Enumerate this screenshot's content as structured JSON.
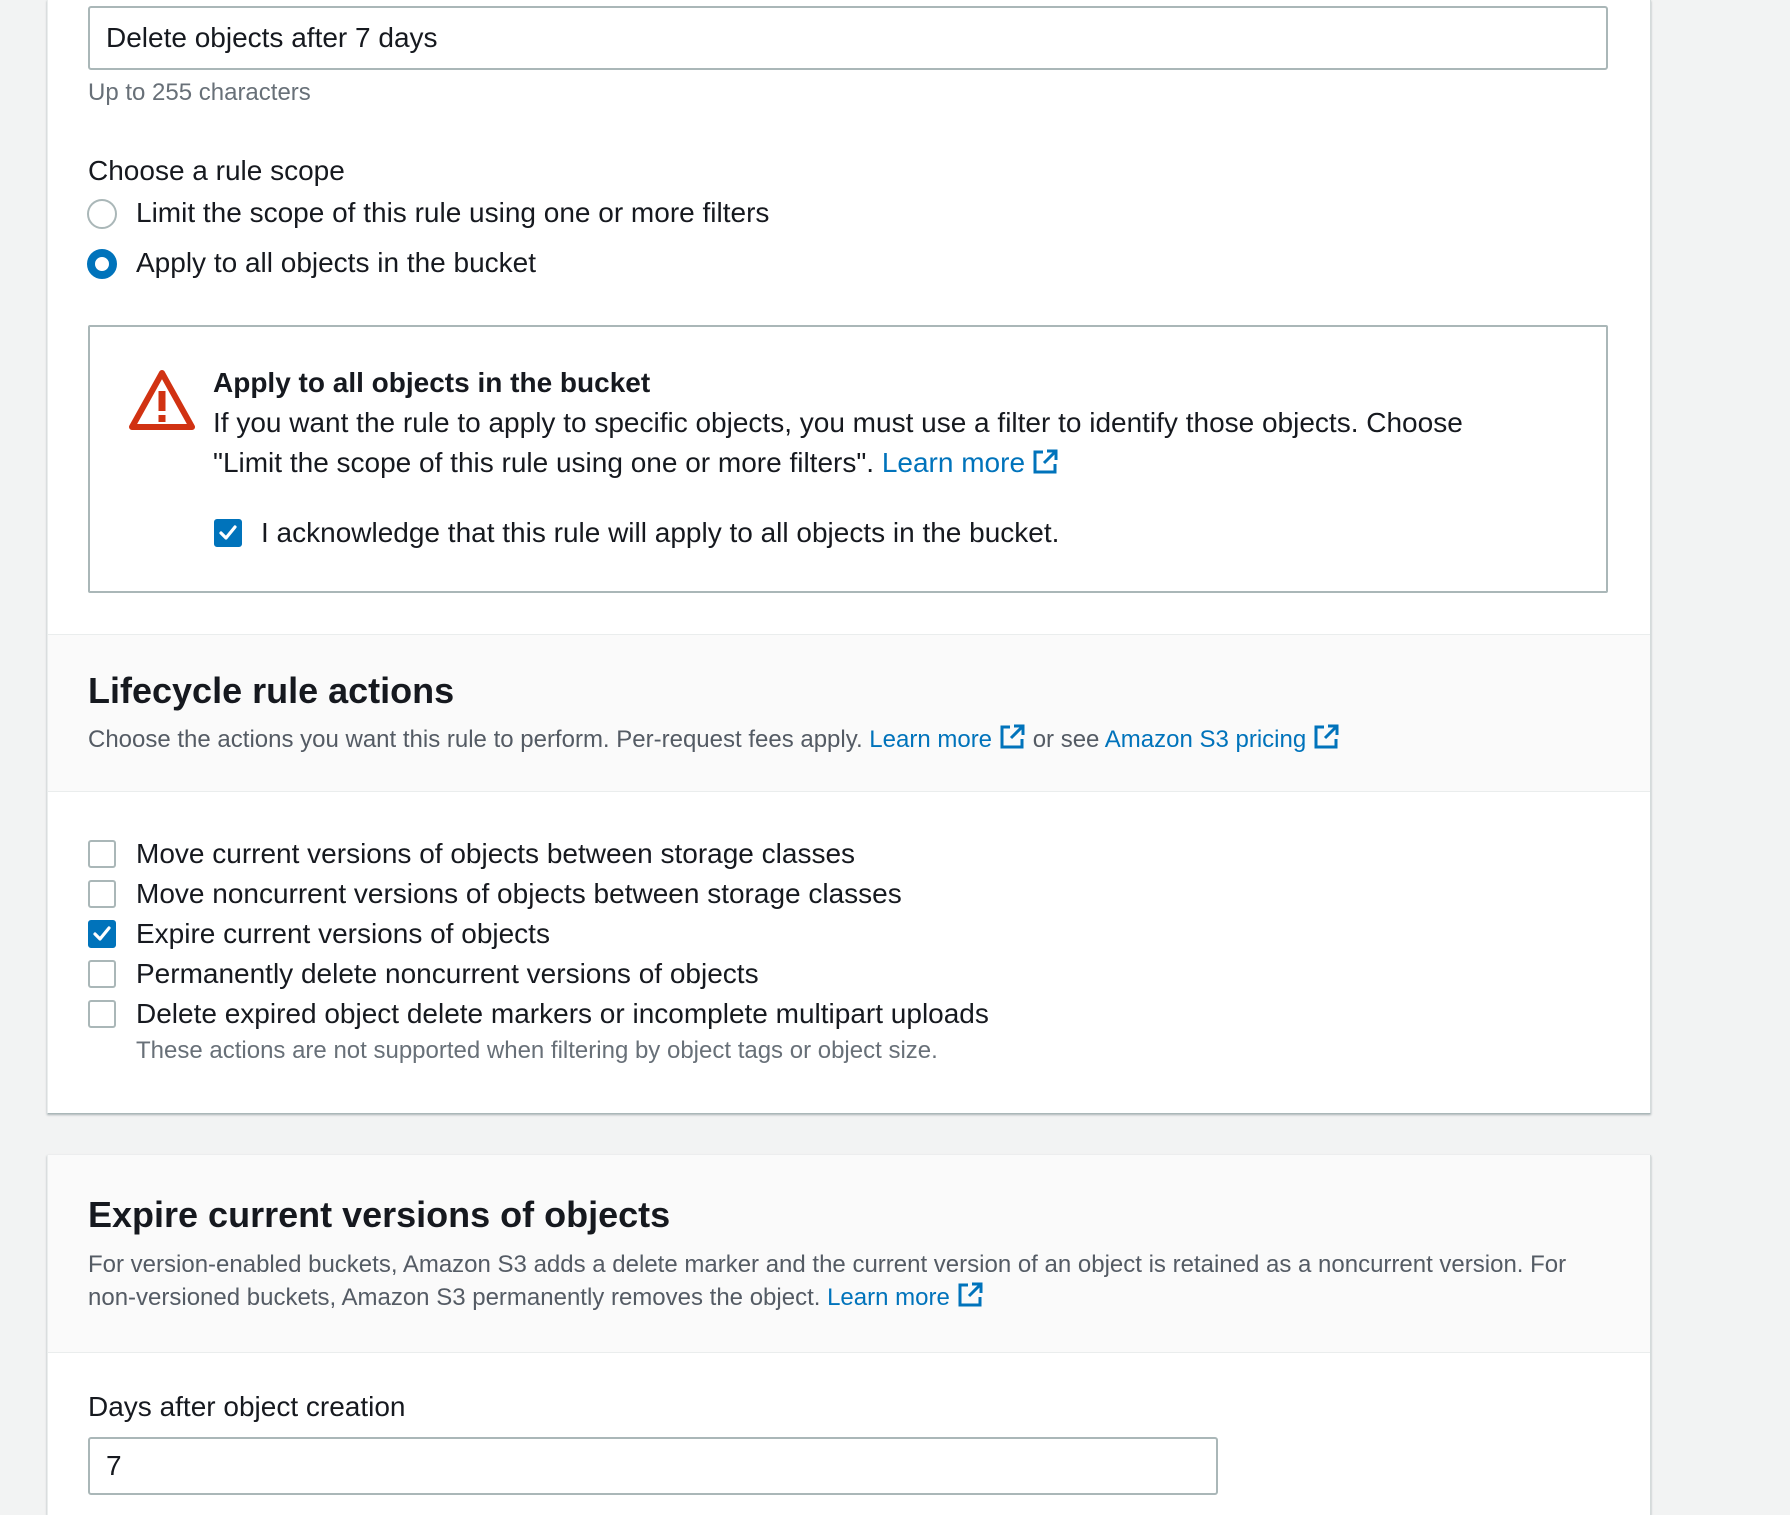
{
  "rule_name": {
    "value": "Delete objects after 7 days",
    "hint": "Up to 255 characters"
  },
  "scope": {
    "label": "Choose a rule scope",
    "options": [
      {
        "label": "Limit the scope of this rule using one or more filters",
        "selected": false
      },
      {
        "label": "Apply to all objects in the bucket",
        "selected": true
      }
    ]
  },
  "warning": {
    "title": "Apply to all objects in the bucket",
    "body_line1": "If you want the rule to apply to specific objects, you must use a filter to identify those objects. Choose",
    "body_line2": "\"Limit the scope of this rule using one or more filters\".",
    "learn_more": "Learn more",
    "acknowledge_label": "I acknowledge that this rule will apply to all objects in the bucket.",
    "acknowledge_checked": true,
    "icon": "warning-triangle-icon",
    "color": "#d13212"
  },
  "lifecycle_actions": {
    "title": "Lifecycle rule actions",
    "description": "Choose the actions you want this rule to perform. Per-request fees apply.",
    "learn_more": "Learn more",
    "or_see": "or see",
    "pricing_link": "Amazon S3 pricing",
    "options": [
      {
        "label": "Move current versions of objects between storage classes",
        "checked": false
      },
      {
        "label": "Move noncurrent versions of objects between storage classes",
        "checked": false
      },
      {
        "label": "Expire current versions of objects",
        "checked": true
      },
      {
        "label": "Permanently delete noncurrent versions of objects",
        "checked": false
      },
      {
        "label": "Delete expired object delete markers or incomplete multipart uploads",
        "checked": false
      }
    ],
    "note": "These actions are not supported when filtering by object tags or object size."
  },
  "expire_section": {
    "title": "Expire current versions of objects",
    "desc_line1": "For version-enabled buckets, Amazon S3 adds a delete marker and the current version of an object is retained as a noncurrent version. For",
    "desc_line2": "non-versioned buckets, Amazon S3 permanently removes the object.",
    "learn_more": "Learn more",
    "days_label": "Days after object creation",
    "days_value": "7"
  },
  "colors": {
    "accent": "#0073bb",
    "warning": "#d13212",
    "background": "#f2f3f3",
    "text": "#16191f",
    "secondary_text": "#545b64"
  }
}
